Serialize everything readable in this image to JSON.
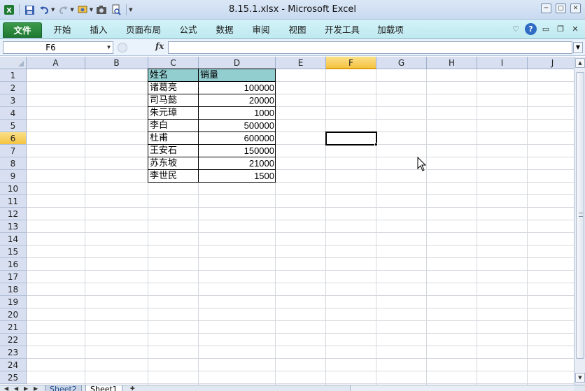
{
  "window": {
    "title": "8.15.1.xlsx  -  Microsoft Excel",
    "controls": [
      "─",
      "▢",
      "✕"
    ]
  },
  "quick_access": {
    "icons": [
      "excel-logo-icon",
      "save-icon",
      "undo-icon",
      "redo-icon",
      "screenshot-icon",
      "camera-icon",
      "print-preview-icon",
      "customize-icon"
    ]
  },
  "ribbon": {
    "tabs": [
      "文件",
      "开始",
      "插入",
      "页面布局",
      "公式",
      "数据",
      "审阅",
      "视图",
      "开发工具",
      "加载项"
    ],
    "active_tab": "文件",
    "right_icons": [
      "collapse-ribbon-icon",
      "help-icon",
      "minimize-icon",
      "restore-icon",
      "close-icon"
    ]
  },
  "formula_bar": {
    "name_box": "F6",
    "fx_label": "fx",
    "formula": ""
  },
  "grid": {
    "columns": [
      "A",
      "B",
      "C",
      "D",
      "E",
      "F",
      "G",
      "H",
      "I",
      "J"
    ],
    "rows": [
      "1",
      "2",
      "3",
      "4",
      "5",
      "6",
      "7",
      "8",
      "9",
      "10",
      "11",
      "12",
      "13",
      "14",
      "15",
      "16",
      "17",
      "18",
      "19",
      "20",
      "21",
      "22",
      "23",
      "24",
      "25"
    ],
    "selected_cell": "F6",
    "table": {
      "header": [
        "姓名",
        "销量"
      ],
      "rows": [
        [
          "诸葛亮",
          "100000"
        ],
        [
          "司马懿",
          "20000"
        ],
        [
          "朱元璋",
          "1000"
        ],
        [
          "李白",
          "500000"
        ],
        [
          "杜甫",
          "600000"
        ],
        [
          "王安石",
          "150000"
        ],
        [
          "苏东坡",
          "21000"
        ],
        [
          "李世民",
          "1500"
        ]
      ]
    }
  },
  "sheet_tabs": [
    "Sheet2",
    "Sheet1"
  ],
  "active_sheet": "Sheet1",
  "colors": {
    "header_fill": "#92cdd0",
    "file_tab": "#2a8a3c",
    "ribbon_bg": "#c8eef4",
    "selection_highlight": "#f5c342"
  }
}
